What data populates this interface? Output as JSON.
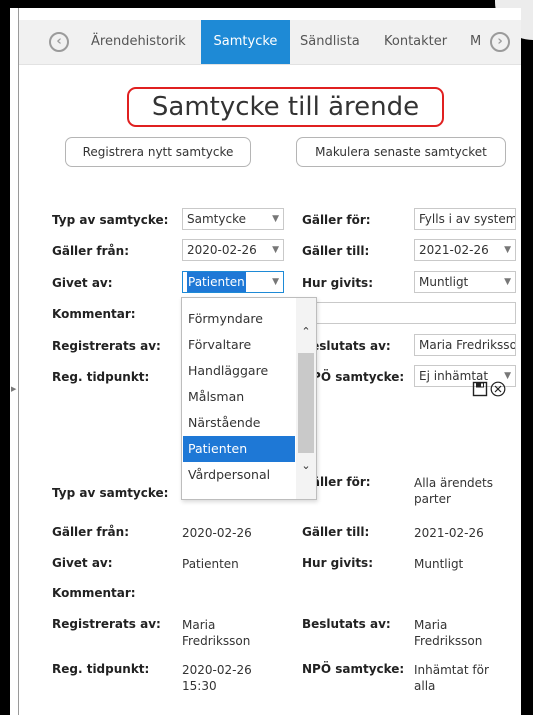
{
  "tabs": [
    "Ärendehistorik",
    "Samtycke",
    "Sändlista",
    "Kontakter",
    "M"
  ],
  "title": "Samtycke till ärende",
  "buttons": {
    "register": "Registrera nytt samtycke",
    "void": "Makulera senaste samtycket"
  },
  "form": {
    "typ_label": "Typ av samtycke:",
    "typ_value": "Samtycke",
    "galler_for_label": "Gäller för:",
    "galler_for_value": "Fylls i av systemet",
    "galler_fran_label": "Gäller från:",
    "galler_fran_value": "2020-02-26",
    "galler_till_label": "Gäller till:",
    "galler_till_value": "2021-02-26",
    "givet_av_label": "Givet av:",
    "givet_av_value": "Patienten",
    "hur_givits_label": "Hur givits:",
    "hur_givits_value": "Muntligt",
    "kommentar_label": "Kommentar:",
    "registrerats_av_label": "Registrerats av:",
    "beslutats_av_label": "Beslutats av:",
    "beslutats_av_value": "Maria Fredriksson",
    "reg_tidpunkt_label": "Reg. tidpunkt:",
    "npo_label": "NPÖ samtycke:",
    "npo_value": "Ej inhämtat"
  },
  "dropdown": {
    "options": [
      "Förmyndare",
      "Förvaltare",
      "Handläggare",
      "Målsman",
      "Närstående",
      "Patienten",
      "Vårdpersonal"
    ],
    "selected": "Patienten"
  },
  "icons": [
    "save-icon",
    "cancel-icon",
    "prev-tab-icon",
    "next-tab-icon"
  ],
  "record": {
    "typ_label": "Typ av samtycke:",
    "galler_for_label": "Gäller för:",
    "galler_for_value": "Alla ärendets parter",
    "galler_fran_label": "Gäller från:",
    "galler_fran_value": "2020-02-26",
    "galler_till_label": "Gäller till:",
    "galler_till_value": "2021-02-26",
    "givet_av_label": "Givet av:",
    "givet_av_value": "Patienten",
    "hur_givits_label": "Hur givits:",
    "hur_givits_value": "Muntligt",
    "kommentar_label": "Kommentar:",
    "registrerats_av_label": "Registrerats av:",
    "registrerats_av_value": "Maria Fredriksson",
    "beslutats_av_label": "Beslutats av:",
    "beslutats_av_value": "Maria Fredriksson",
    "reg_tidpunkt_label": "Reg. tidpunkt:",
    "reg_tidpunkt_value": "2020-02-26 15:30",
    "npo_label": "NPÖ samtycke:",
    "npo_value": "Inhämtat för alla"
  },
  "colors": {
    "accent": "#1e8ad6",
    "highlight": "#1e78d6",
    "title_border": "#e02020"
  }
}
